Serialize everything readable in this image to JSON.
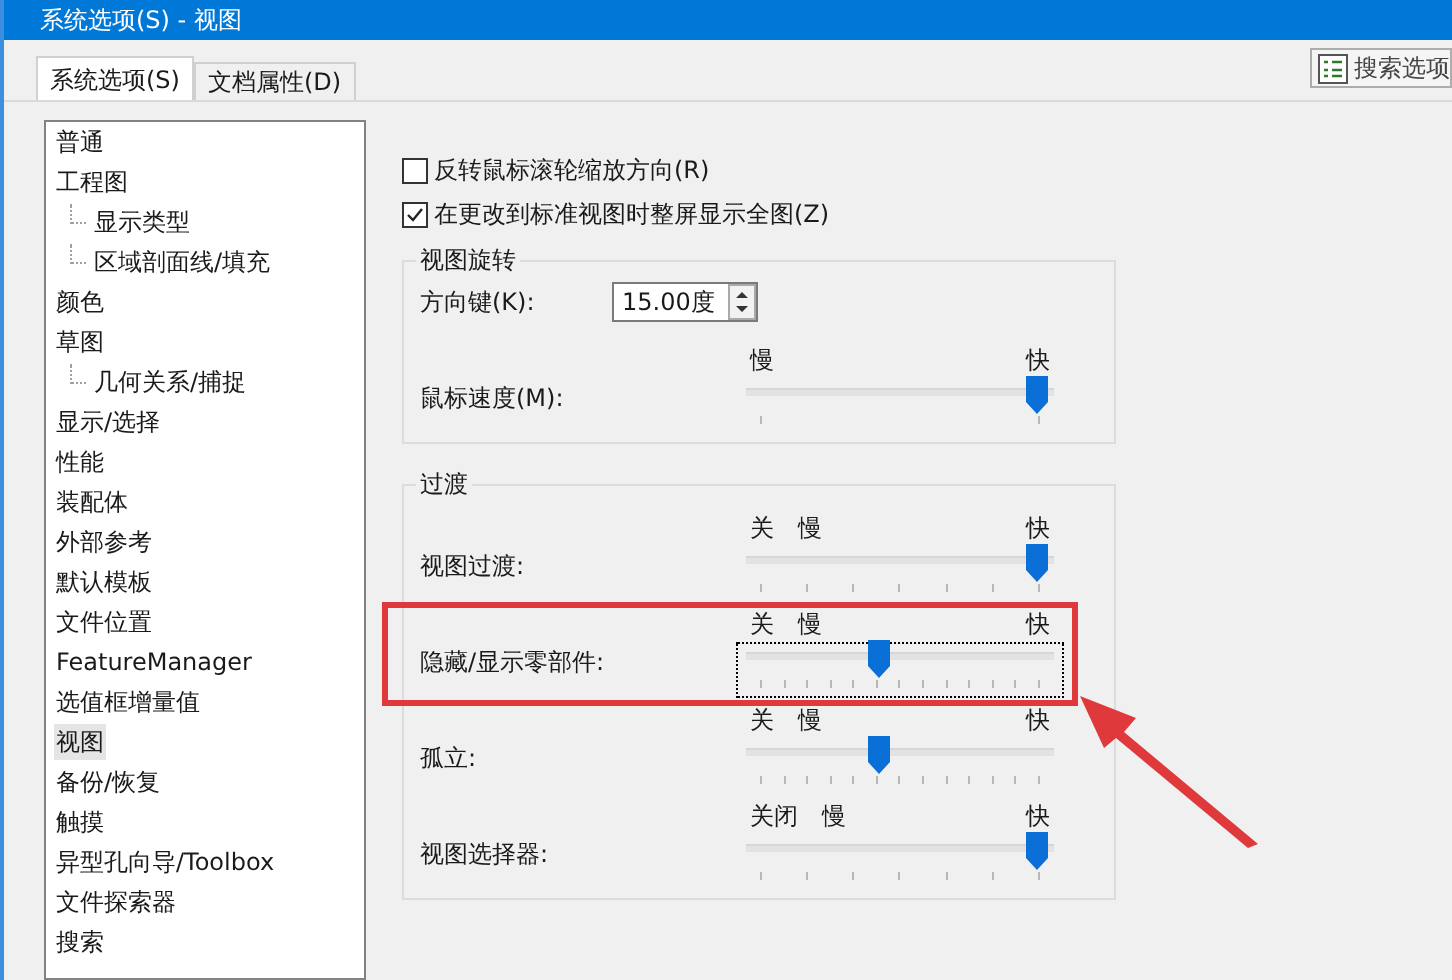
{
  "window": {
    "title": "系统选项(S) - 视图"
  },
  "tabs": [
    {
      "label": "系统选项(S)",
      "selected": true
    },
    {
      "label": "文档属性(D)",
      "selected": false
    }
  ],
  "search_button": {
    "label": "搜索选项"
  },
  "tree": [
    {
      "label": "普通",
      "selected": false
    },
    {
      "label": "工程图",
      "selected": false,
      "children": [
        {
          "label": "显示类型",
          "selected": false
        },
        {
          "label": "区域剖面线/填充",
          "selected": false
        }
      ]
    },
    {
      "label": "颜色",
      "selected": false
    },
    {
      "label": "草图",
      "selected": false,
      "children": [
        {
          "label": "几何关系/捕捉",
          "selected": false
        }
      ]
    },
    {
      "label": "显示/选择",
      "selected": false
    },
    {
      "label": "性能",
      "selected": false
    },
    {
      "label": "装配体",
      "selected": false
    },
    {
      "label": "外部参考",
      "selected": false
    },
    {
      "label": "默认模板",
      "selected": false
    },
    {
      "label": "文件位置",
      "selected": false
    },
    {
      "label": "FeatureManager",
      "selected": false
    },
    {
      "label": "选值框增量值",
      "selected": false
    },
    {
      "label": "视图",
      "selected": true
    },
    {
      "label": "备份/恢复",
      "selected": false
    },
    {
      "label": "触摸",
      "selected": false
    },
    {
      "label": "异型孔向导/Toolbox",
      "selected": false
    },
    {
      "label": "文件探索器",
      "selected": false
    },
    {
      "label": "搜索",
      "selected": false
    }
  ],
  "checkboxes": [
    {
      "label": "反转鼠标滚轮缩放方向(R)",
      "checked": false
    },
    {
      "label": "在更改到标准视图时整屏显示全图(Z)",
      "checked": true
    }
  ],
  "view_rotation": {
    "title": "视图旋转",
    "arrow_keys": {
      "label": "方向键(K):",
      "value": "15.00度"
    },
    "sliders": [
      {
        "label": "鼠标速度(M):",
        "left_labels": [
          "慢"
        ],
        "right_label": "快",
        "level": 1,
        "focused": false
      }
    ]
  },
  "transitions": {
    "title": "过渡",
    "sliders": [
      {
        "label": "视图过渡:",
        "left_labels": [
          "关",
          "慢"
        ],
        "right_label": "快",
        "level": 1,
        "focused": false
      },
      {
        "label": "隐藏/显示零部件:",
        "left_labels": [
          "关",
          "慢"
        ],
        "right_label": "快",
        "level": 0.42,
        "focused": true
      },
      {
        "label": "孤立:",
        "left_labels": [
          "关",
          "慢"
        ],
        "right_label": "快",
        "level": 0.42,
        "focused": false
      },
      {
        "label": "视图选择器:",
        "left_labels": [
          "关闭",
          "慢"
        ],
        "right_label": "快",
        "level": 1,
        "focused": false
      }
    ]
  }
}
